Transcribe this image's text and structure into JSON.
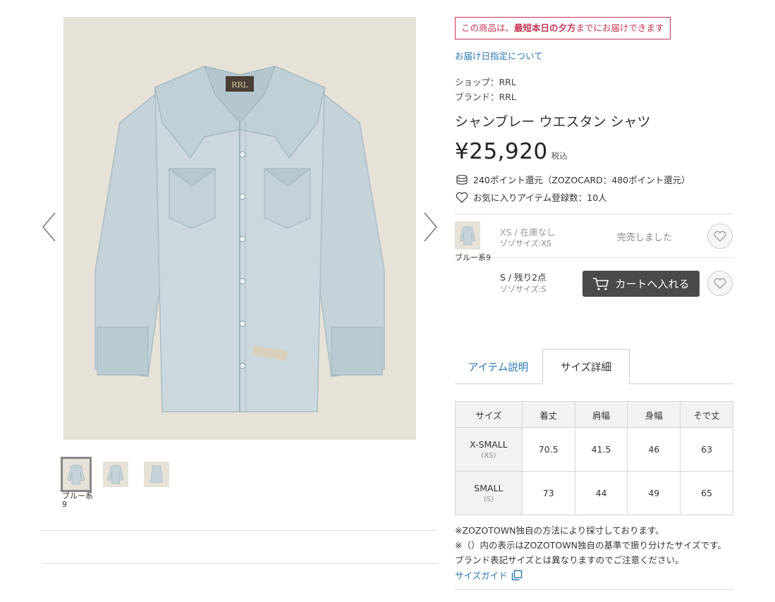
{
  "gallery": {
    "thumbnails": [
      {
        "caption": "ブルー系9",
        "selected": true
      },
      {
        "caption": "",
        "selected": false
      },
      {
        "caption": "",
        "selected": false
      }
    ]
  },
  "delivery": {
    "badge_prefix": "この商品は、",
    "badge_emphasis": "最短本日の夕方",
    "badge_suffix": "までにお届けできます",
    "link": "お届け日指定について"
  },
  "meta": {
    "shop": "ショップ：RRL",
    "brand": "ブランド：RRL"
  },
  "product": {
    "name": "シャンブレー ウエスタン シャツ",
    "price": "¥25,920",
    "tax": "税込",
    "points": "240ポイント還元（ZOZOCARD：480ポイント還元）",
    "favorites": "お気に入りアイテム登録数：10人"
  },
  "skus": {
    "color_caption": "ブルー系9",
    "rows": [
      {
        "size": "XS / 在庫なし",
        "zozo_size": "ゾゾサイズ:XS",
        "status": "完売しました"
      },
      {
        "size": "S / 残り2点",
        "zozo_size": "ゾゾサイズ:S",
        "button": "カートへ入れる"
      }
    ]
  },
  "tabs": {
    "description": "アイテム説明",
    "size_detail": "サイズ詳細"
  },
  "size_table": {
    "headers": [
      "サイズ",
      "着丈",
      "肩幅",
      "身幅",
      "そで丈"
    ],
    "rows": [
      {
        "size": "X-SMALL",
        "sub": "(XS)",
        "values": [
          "70.5",
          "41.5",
          "46",
          "63"
        ]
      },
      {
        "size": "SMALL",
        "sub": "(S)",
        "values": [
          "73",
          "44",
          "49",
          "65"
        ]
      }
    ]
  },
  "notes": {
    "line1": "※ZOZOTOWN独自の方法により採寸しております。",
    "line2": "※（）内の表示はZOZOTOWN独自の基準で振り分けたサイズです。ブランド表記サイズとは異なりますのでご注意ください。",
    "guide_link": "サイズガイド"
  },
  "colors": {
    "accent_red": "#c73556",
    "link_blue": "#2978b5",
    "cart_button": "#4a4a4a"
  }
}
